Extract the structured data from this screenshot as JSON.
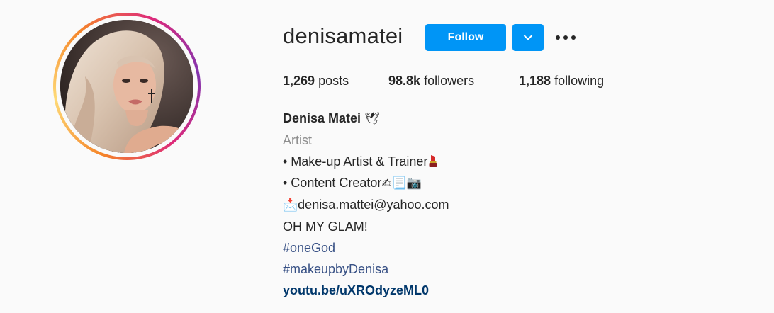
{
  "profile": {
    "username": "denisamatei",
    "follow_label": "Follow",
    "more_label": "•••",
    "dropdown_icon": "chevron-down-icon"
  },
  "stats": {
    "posts_count": "1,269",
    "posts_label": "posts",
    "followers_count": "98.8k",
    "followers_label": "followers",
    "following_count": "1,188",
    "following_label": "following"
  },
  "bio": {
    "full_name": "Denisa Matei",
    "name_emoji": "🕊",
    "category": "Artist",
    "line1": "• Make-up Artist & Trainer",
    "line2": "• Content Creator",
    "line2_emojis": "✍📃📷",
    "email_icon": "📩",
    "email": "denisa.mattei@yahoo.com",
    "tagline": "OH MY GLAM!",
    "hashtag1": "#oneGod",
    "hashtag2": "#makeupbyDenisa",
    "link": "youtu.be/uXROdyzeML0"
  },
  "colors": {
    "follow_blue": "#0095f6",
    "hashtag_blue": "#385185",
    "link_blue": "#00376b",
    "category_gray": "#8e8e8e",
    "background": "#fafafa"
  }
}
